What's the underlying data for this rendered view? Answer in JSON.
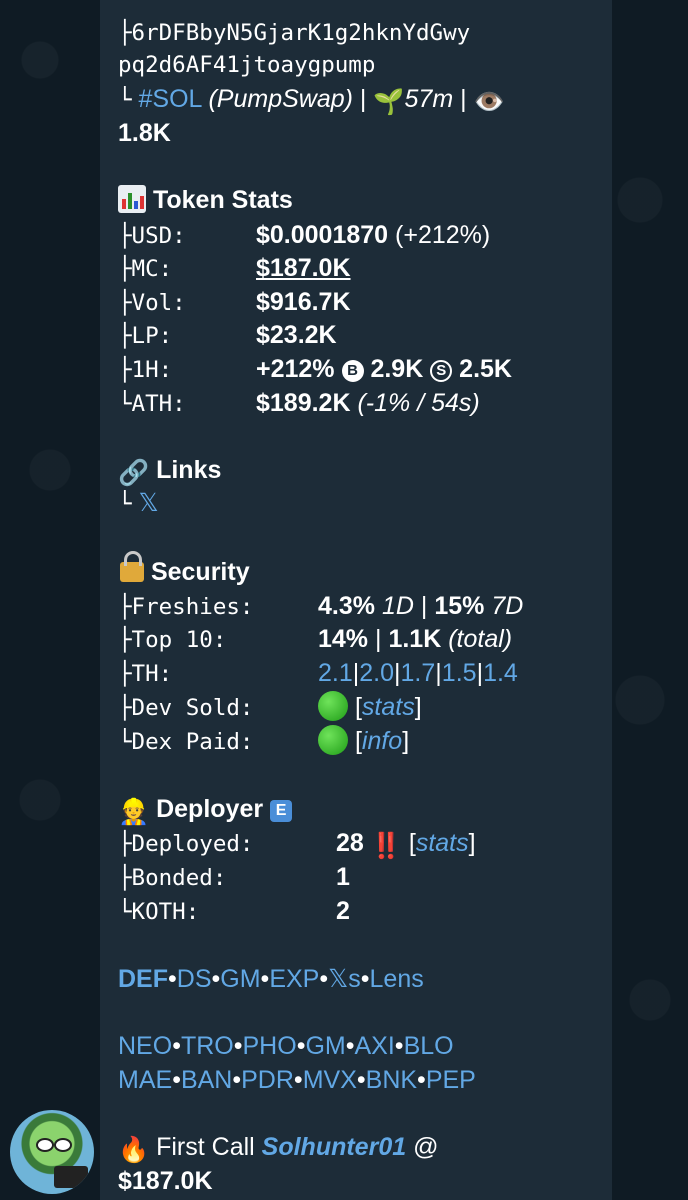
{
  "header": {
    "address_line1": "├6rDFBbyN5GjarK1g2hknYdGwy",
    "address_line2": "pq2d6AF41jtoaygpump",
    "chain_prefix": "└",
    "chain_tag": "#SOL",
    "dex": "(PumpSwap)",
    "sep1": "|",
    "age_emoji": "🌱",
    "age": "57m",
    "sep2": "|",
    "views_emoji": "👁️",
    "views": "1.8K"
  },
  "token_stats": {
    "title": "Token Stats",
    "rows": [
      {
        "tree": "├",
        "label": "USD:",
        "value": "$0.0001870",
        "extra": "(+212%)"
      },
      {
        "tree": "├",
        "label": "MC:",
        "value": "$187.0K"
      },
      {
        "tree": "├",
        "label": "Vol:",
        "value": "$916.7K"
      },
      {
        "tree": "├",
        "label": "LP:",
        "value": "$23.2K"
      },
      {
        "tree": "├",
        "label": "1H:",
        "value": "+212%",
        "b_badge": "B",
        "b_value": "2.9K",
        "s_badge": "S",
        "s_value": "2.5K"
      },
      {
        "tree": "└",
        "label": "ATH:",
        "value": "$189.2K",
        "extra": "(-1% / 54s)"
      }
    ]
  },
  "links": {
    "emoji": "🔗",
    "title": "Links",
    "tree": "└",
    "x_link": "𝕏"
  },
  "security": {
    "title": "Security",
    "rows": [
      {
        "tree": "├",
        "label": "Freshies:",
        "v1": "4.3%",
        "v1_unit": "1D",
        "sep": "|",
        "v2": "15%",
        "v2_unit": "7D"
      },
      {
        "tree": "├",
        "label": "Top 10:",
        "v1": "14%",
        "sep": "|",
        "v2": "1.1K",
        "v2_unit": "(total)"
      },
      {
        "tree": "├",
        "label": "TH:",
        "th": [
          "2.1",
          "2.0",
          "1.7",
          "1.5",
          "1.4"
        ],
        "sep": "|"
      },
      {
        "tree": "├",
        "label": "Dev Sold:",
        "link_open": "[",
        "link": "stats",
        "link_close": "]"
      },
      {
        "tree": "└",
        "label": "Dex Paid:",
        "link_open": "[",
        "link": "info",
        "link_close": "]"
      }
    ]
  },
  "deployer": {
    "emoji": "👷",
    "title": "Deployer",
    "badge": "E",
    "rows": [
      {
        "tree": "├",
        "label": "Deployed:",
        "value": "28",
        "alert": "‼️",
        "link_open": "[",
        "link": "stats",
        "link_close": "]"
      },
      {
        "tree": "├",
        "label": "Bonded:",
        "value": "1"
      },
      {
        "tree": "└",
        "label": "KOTH:",
        "value": "2"
      }
    ]
  },
  "tools_row": {
    "items": [
      "DEF",
      "DS",
      "GM",
      "EXP",
      "𝕏s",
      "Lens"
    ],
    "sep": "•"
  },
  "bots_row1": {
    "items": [
      "NEO",
      "TRO",
      "PHO",
      "GM",
      "AXI",
      "BLO"
    ],
    "sep": "•"
  },
  "bots_row2": {
    "items": [
      "MAE",
      "BAN",
      "PDR",
      "MVX",
      "BNK",
      "PEP"
    ],
    "sep": "•"
  },
  "first_call": {
    "emoji": "🔥",
    "label": "First Call",
    "caller": "Solhunter01",
    "at": "@",
    "value": "$187.0K"
  },
  "colors": {
    "background": "#0f1b24",
    "bubble": "#1d2c38",
    "link": "#62a8e5",
    "text": "#ffffff"
  }
}
